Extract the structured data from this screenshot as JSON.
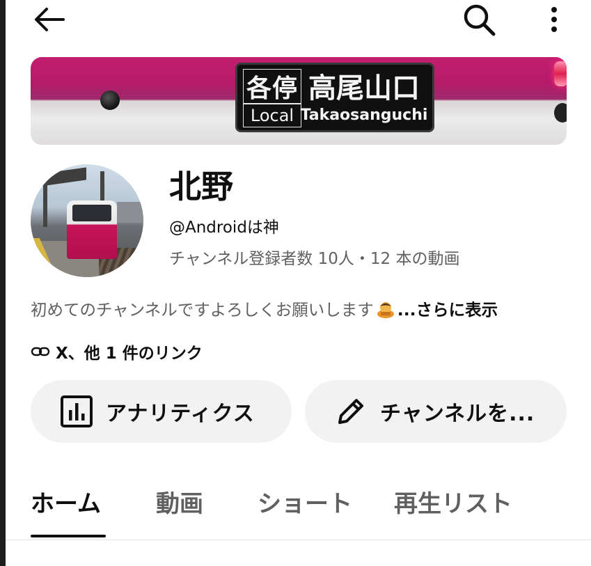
{
  "topbar": {
    "back_icon": "arrow-left-icon",
    "search_icon": "search-icon",
    "more_icon": "more-vert-icon"
  },
  "banner": {
    "service_jp": "各停",
    "service_en": "Local",
    "destination_jp": "高尾山口",
    "destination_en": "Takaosanguchi"
  },
  "channel": {
    "name": "北野",
    "handle": "@Androidは神",
    "stats": "チャンネル登録者数 10人・12 本の動画",
    "description": "初めてのチャンネルですよろしくお願いします",
    "description_emoji": "bowing-person-emoji",
    "more_label": "...さらに表示",
    "links_label": "X、他 1 件のリンク",
    "links_icon": "link-icon"
  },
  "actions": {
    "analytics_label": "アナリティクス",
    "analytics_icon": "bar-chart-icon",
    "edit_label": "チャンネルを...",
    "edit_icon": "pencil-icon"
  },
  "tabs": [
    {
      "label": "ホーム",
      "active": true
    },
    {
      "label": "動画",
      "active": false
    },
    {
      "label": "ショート",
      "active": false
    },
    {
      "label": "再生リスト",
      "active": false
    }
  ],
  "colors": {
    "text_primary": "#0f0f0f",
    "text_secondary": "#606060",
    "pill_bg": "#f2f2f2",
    "banner_magenta": "#c41e70"
  }
}
